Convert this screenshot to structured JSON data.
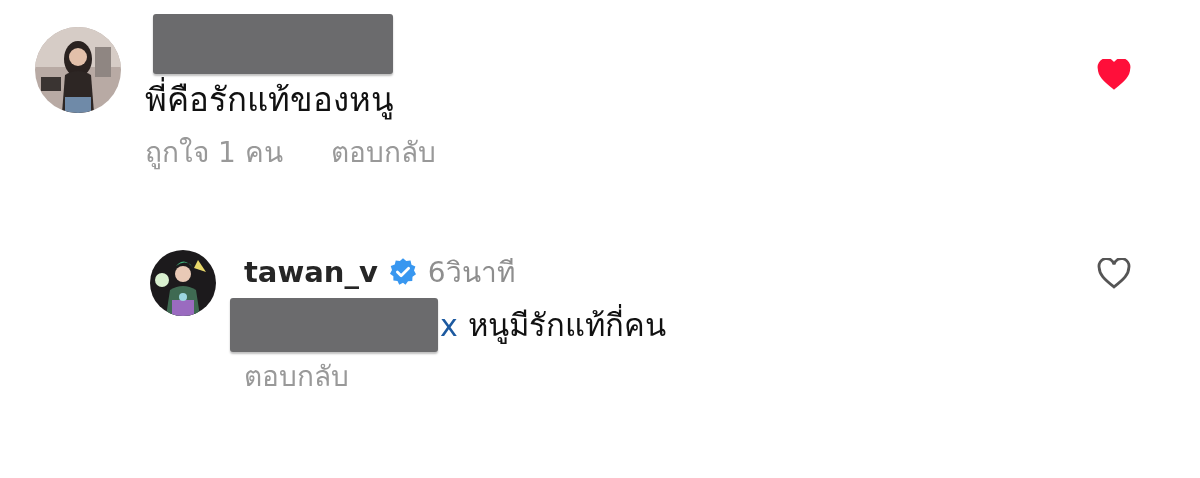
{
  "comments": [
    {
      "username_redacted": true,
      "text": "พี่คือรักแท้ของหนู",
      "likes": "ถูกใจ 1 คน",
      "reply_label": "ตอบกลับ",
      "liked": true,
      "replies": [
        {
          "username": "tawan_v",
          "verified": true,
          "time": "6วินาที",
          "mention_tail": "x",
          "text": "หนูมีรักแท้กี่คน",
          "reply_label": "ตอบกลับ",
          "liked": false
        }
      ]
    }
  ]
}
